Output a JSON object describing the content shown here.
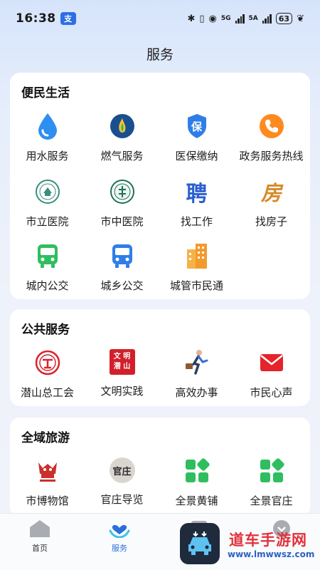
{
  "status_bar": {
    "time": "16:38",
    "app_badge": "支",
    "network1": "5G",
    "network2": "5A",
    "battery": "63"
  },
  "page_title": "服务",
  "sections": [
    {
      "title": "便民生活",
      "items": [
        {
          "label": "用水服务",
          "icon": "water-drop-icon"
        },
        {
          "label": "燃气服务",
          "icon": "gas-flame-icon"
        },
        {
          "label": "医保缴纳",
          "icon": "insurance-shield-icon",
          "glyph": "保"
        },
        {
          "label": "政务服务热线",
          "icon": "phone-icon"
        },
        {
          "label": "市立医院",
          "icon": "hospital-emblem-icon"
        },
        {
          "label": "市中医院",
          "icon": "tcm-hospital-emblem-icon"
        },
        {
          "label": "找工作",
          "icon": "job-icon",
          "glyph": "聘"
        },
        {
          "label": "找房子",
          "icon": "house-icon",
          "glyph": "房"
        },
        {
          "label": "城内公交",
          "icon": "bus-icon"
        },
        {
          "label": "城乡公交",
          "icon": "bus-icon"
        },
        {
          "label": "城管市民通",
          "icon": "building-icon"
        }
      ]
    },
    {
      "title": "公共服务",
      "items": [
        {
          "label": "潜山总工会",
          "icon": "union-emblem-icon"
        },
        {
          "label": "文明实践",
          "icon": "civilization-seal-icon",
          "glyph_lines": [
            "文 明",
            "潜 山"
          ]
        },
        {
          "label": "高效办事",
          "icon": "running-person-icon"
        },
        {
          "label": "市民心声",
          "icon": "mail-icon"
        }
      ]
    },
    {
      "title": "全域旅游",
      "items": [
        {
          "label": "市博物馆",
          "icon": "museum-logo-icon"
        },
        {
          "label": "官庄导览",
          "icon": "guanzhuang-calligraphy-icon",
          "glyph": "官庄"
        },
        {
          "label": "全景黄铺",
          "icon": "panorama-grid-icon"
        },
        {
          "label": "全景官庄",
          "icon": "panorama-grid-icon"
        }
      ]
    }
  ],
  "tab_bar": {
    "tabs": [
      {
        "label": "首页",
        "icon": "home-icon"
      },
      {
        "label": "服务",
        "icon": "heart-hands-icon",
        "active": true
      },
      {
        "label": "",
        "icon": "news-icon"
      },
      {
        "label": "",
        "icon": "profile-icon"
      }
    ]
  },
  "overlay": {
    "watermark_text": "道车手游网",
    "watermark_url": "www.lmwwsz.com"
  },
  "colors": {
    "accent": "#2a6fdb",
    "water": "#2f8ff0",
    "orange": "#ff8a1f",
    "green": "#2fbe5f",
    "red": "#e5232b"
  }
}
